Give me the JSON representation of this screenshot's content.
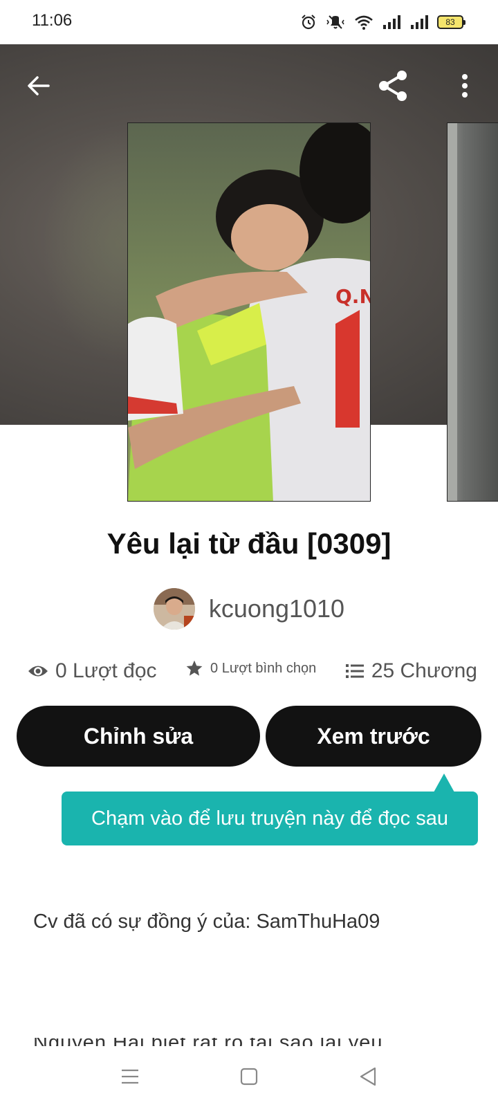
{
  "status_bar": {
    "time": "11:06",
    "battery": "83"
  },
  "toolbar": {
    "back_icon": "arrow-left-icon",
    "share_icon": "share-icon",
    "more_icon": "more-vertical-icon"
  },
  "story": {
    "title": "Yêu lại từ đầu [0309]",
    "author": "kcuong1010",
    "stats": {
      "reads": "0 Lượt đọc",
      "votes": "0 Lượt bình chọn",
      "chapters": "25 Chương"
    },
    "description": "Cv đã có sự đồng ý của: SamThuHa09",
    "description_next_line": "Nguyễn Hải biết rất rõ tại sao lại yêu cậu tôi"
  },
  "actions": {
    "edit_label": "Chỉnh sửa",
    "preview_label": "Xem trước"
  },
  "tooltip": {
    "text": "Chạm vào để lưu truyện này để đọc sau"
  },
  "colors": {
    "button_bg": "#121212",
    "tooltip_bg": "#1ab4ae",
    "hero_bg": "#55504c"
  }
}
